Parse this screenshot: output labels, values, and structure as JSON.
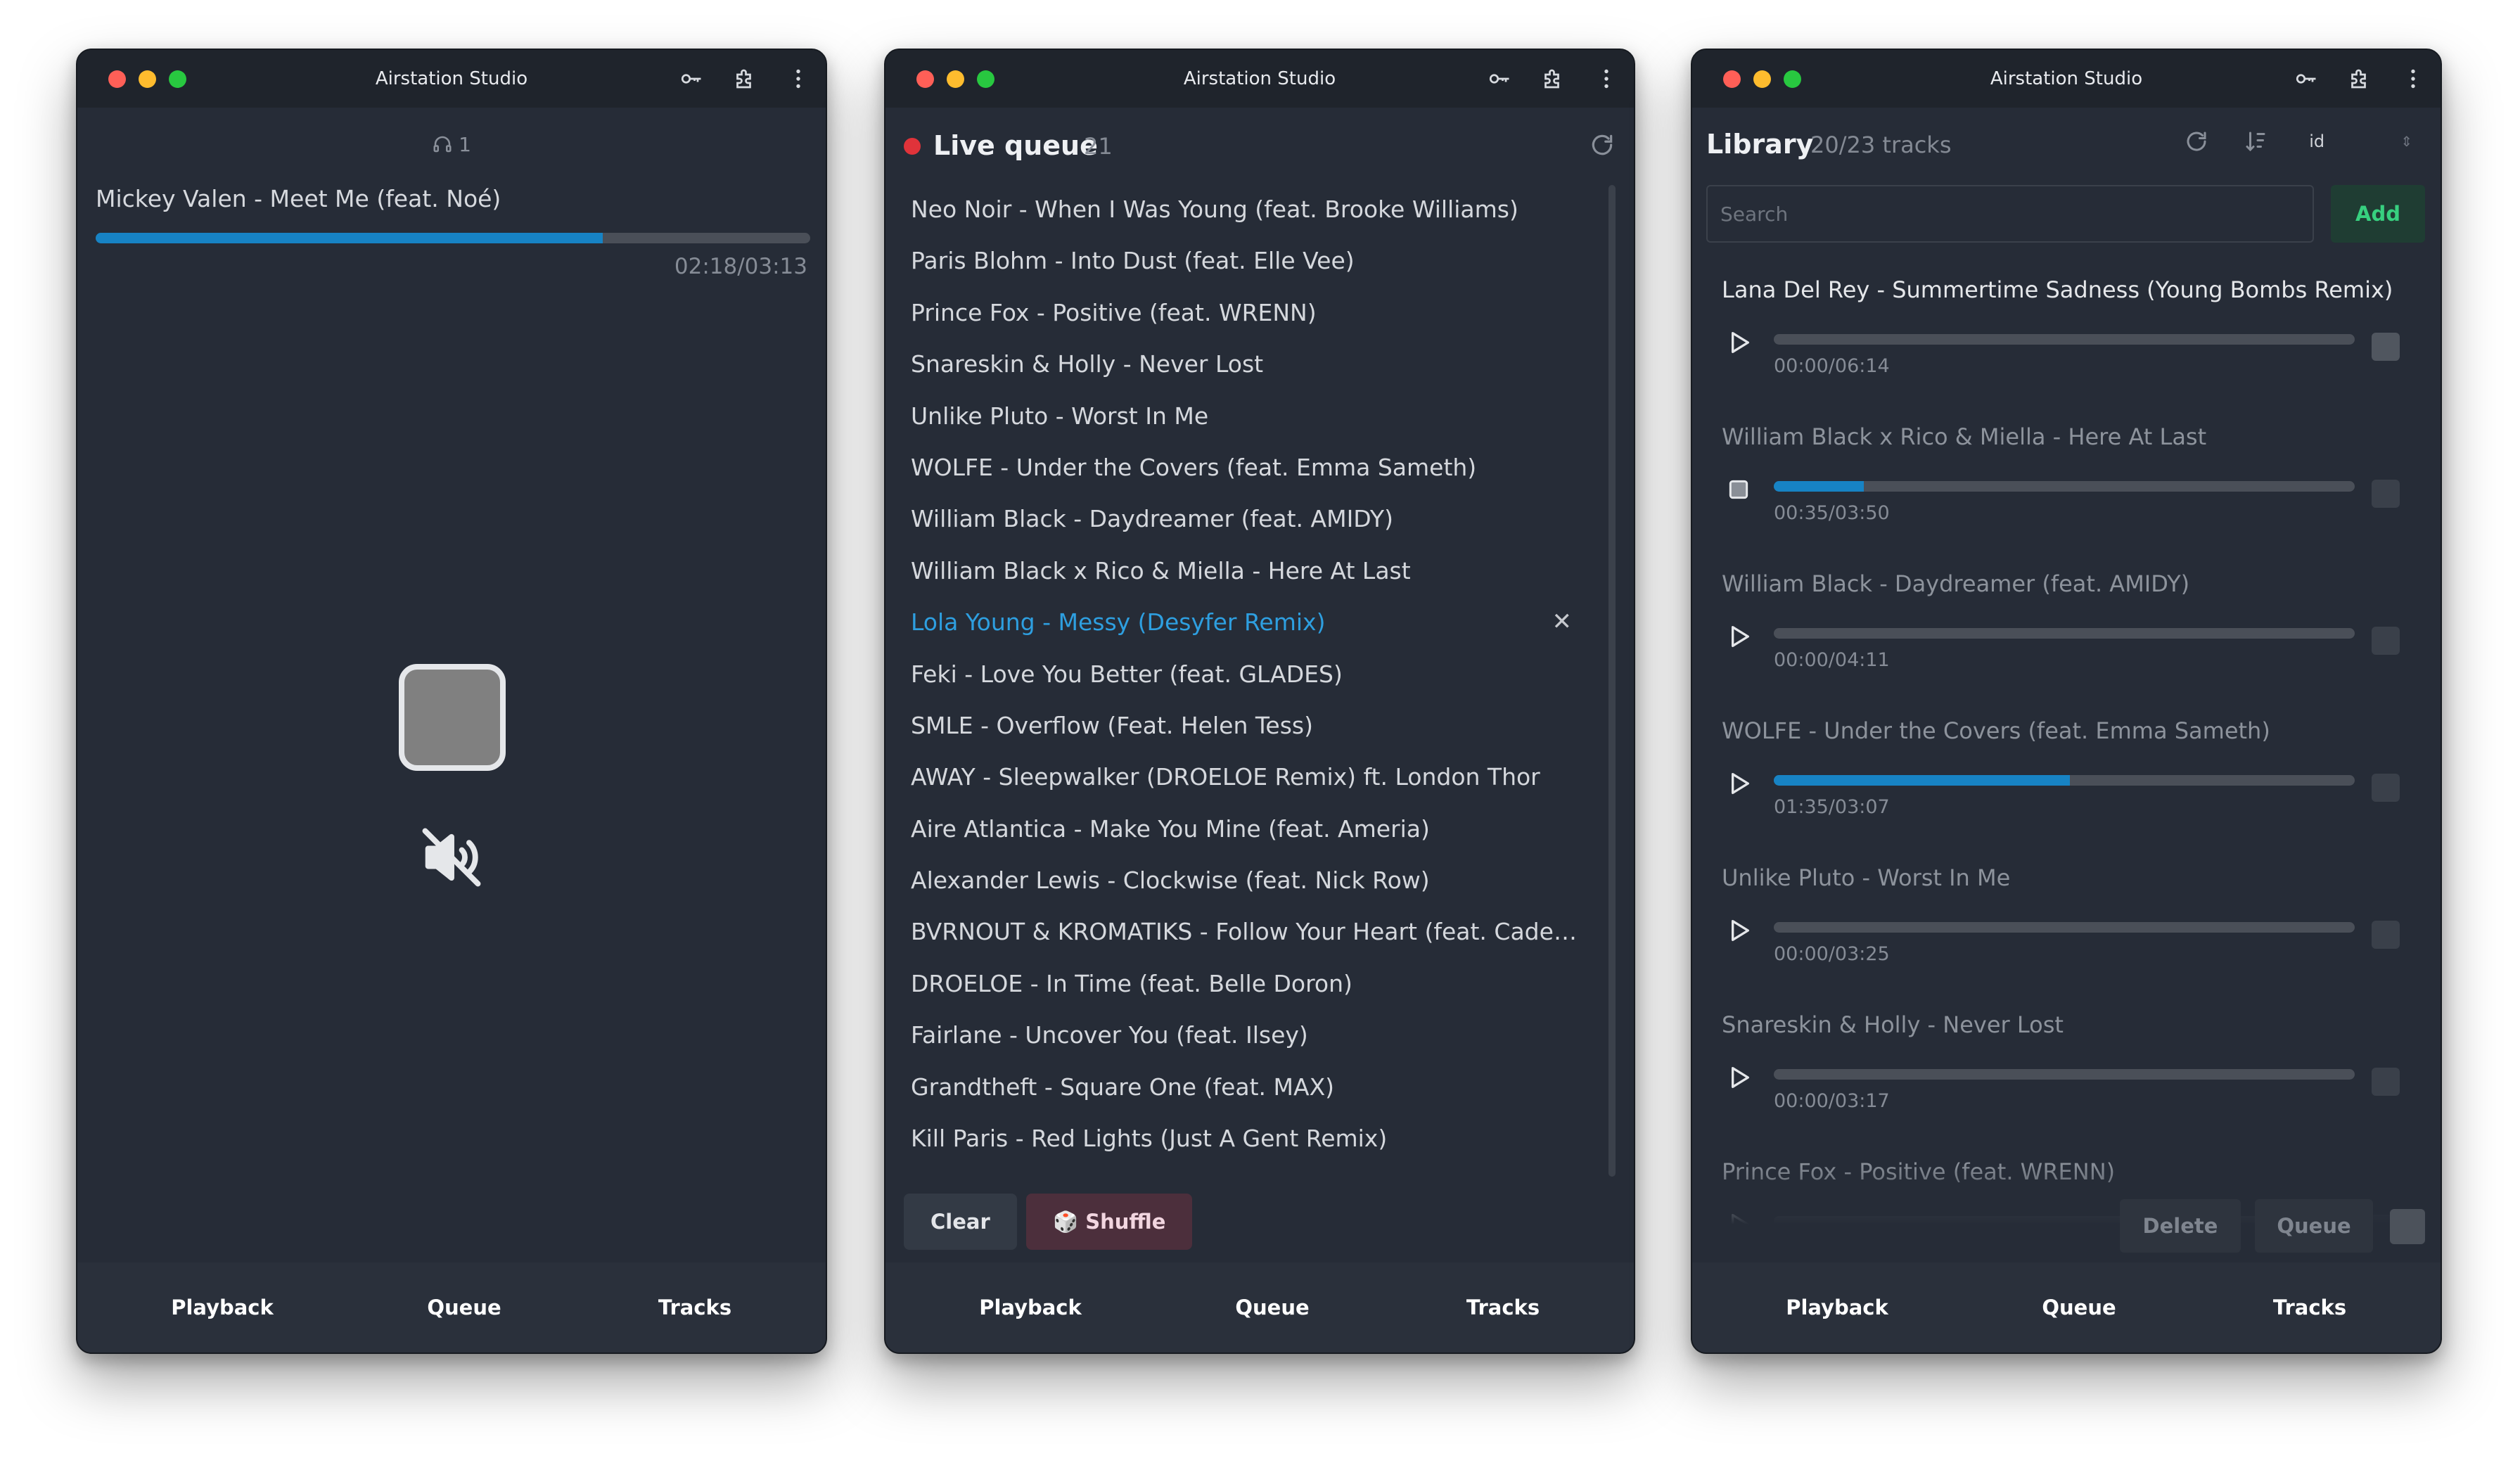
{
  "windows": [
    {
      "title": "Airstation Studio",
      "nav": [
        "Playback",
        "Queue",
        "Tracks"
      ]
    },
    {
      "title": "Airstation Studio",
      "nav": [
        "Playback",
        "Queue",
        "Tracks"
      ]
    },
    {
      "title": "Airstation Studio",
      "nav": [
        "Playback",
        "Queue",
        "Tracks"
      ]
    }
  ],
  "playback": {
    "listeners": "1",
    "now_playing": "Mickey Valen - Meet Me (feat. Noé)",
    "time": "02:18/03:13",
    "progress": 0.71,
    "stop_icon": "stop-icon",
    "mute_icon": "volume-muted-icon"
  },
  "queue": {
    "title": "Live queue",
    "count": "21",
    "items": [
      "Neo Noir - When I Was Young (feat. Brooke Williams)",
      "Paris Blohm - Into Dust (feat. Elle Vee)",
      "Prince Fox - Positive (feat. WRENN)",
      "Snareskin & Holly - Never Lost",
      "Unlike Pluto - Worst In Me",
      "WOLFE - Under the Covers (feat. Emma Sameth)",
      "William Black - Daydreamer (feat. AMIDY)",
      "William Black x Rico & Miella - Here At Last",
      "Lola Young - Messy (Desyfer Remix)",
      "Feki - Love You Better (feat. GLADES)",
      "SMLE - Overflow (Feat. Helen Tess)",
      "AWAY - Sleepwalker (DROELOE Remix) ft. London Thor",
      "Aire Atlantica - Make You Mine (feat. Ameria)",
      "Alexander Lewis - Clockwise (feat. Nick Row)",
      "BVRNOUT & KROMATIKS - Follow Your Heart (feat. Cadence Lu…",
      "DROELOE - In Time (feat. Belle Doron)",
      "Fairlane - Uncover You (feat. Ilsey)",
      "Grandtheft - Square One (feat. MAX)",
      "Kill Paris - Red Lights (Just A Gent Remix)"
    ],
    "active_index": 8,
    "remove_glyph": "✕",
    "clear_label": "Clear",
    "shuffle_label": "🎲 Shuffle",
    "accent": "#2e9fe0"
  },
  "library": {
    "title": "Library",
    "count": "20/23 tracks",
    "sort_field": "id",
    "search_placeholder": "Search",
    "add_label": "Add",
    "tracks": [
      {
        "name": "Lana Del Rey - Summertime Sadness (Young Bombs Remix)",
        "time": "00:00/06:14",
        "progress": 0.0,
        "state": "play"
      },
      {
        "name": "William Black x Rico & Miella - Here At Last",
        "time": "00:35/03:50",
        "progress": 0.155,
        "state": "stop"
      },
      {
        "name": "William Black - Daydreamer (feat. AMIDY)",
        "time": "00:00/04:11",
        "progress": 0.0,
        "state": "play"
      },
      {
        "name": "WOLFE - Under the Covers (feat. Emma Sameth)",
        "time": "01:35/03:07",
        "progress": 0.51,
        "state": "play"
      },
      {
        "name": "Unlike Pluto - Worst In Me",
        "time": "00:00/03:25",
        "progress": 0.0,
        "state": "play"
      },
      {
        "name": "Snareskin & Holly - Never Lost",
        "time": "00:00/03:17",
        "progress": 0.0,
        "state": "play"
      },
      {
        "name": "Prince Fox - Positive (feat. WRENN)",
        "time": "",
        "progress": 0.0,
        "state": "play"
      }
    ],
    "delete_label": "Delete",
    "queue_label": "Queue"
  }
}
